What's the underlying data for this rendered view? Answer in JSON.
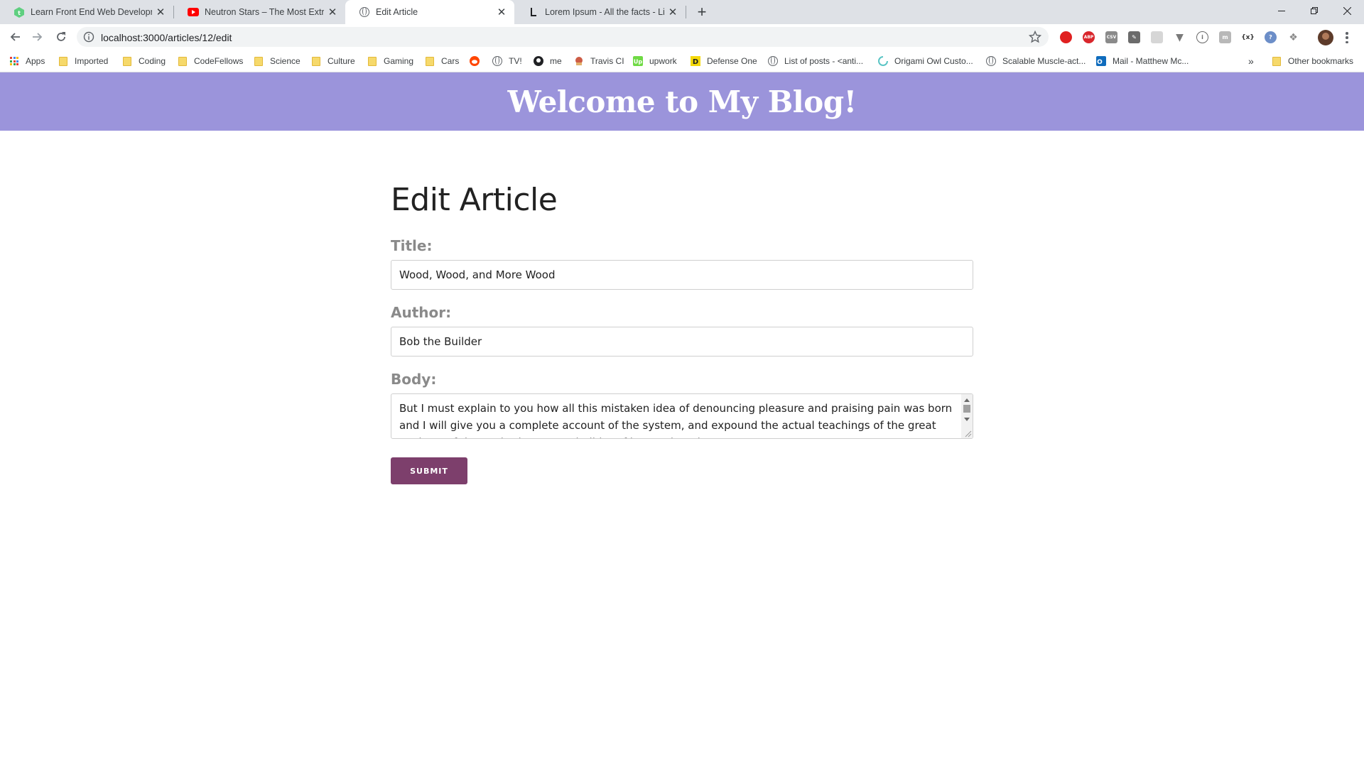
{
  "browser": {
    "tabs": [
      {
        "title": "Learn Front End Web Development",
        "active": false,
        "favicon": "treehouse-icon"
      },
      {
        "title": "Neutron Stars – The Most Extreme",
        "active": false,
        "favicon": "youtube-icon"
      },
      {
        "title": "Edit Article",
        "active": true,
        "favicon": "globe-icon"
      },
      {
        "title": "Lorem Ipsum - All the facts - Lipsum",
        "active": false,
        "favicon": "lipsum-icon"
      }
    ],
    "url": "localhost:3000/articles/12/edit",
    "bookmarks": [
      {
        "label": "Apps",
        "icon": "apps-grid-icon"
      },
      {
        "label": "Imported",
        "icon": "folder-icon"
      },
      {
        "label": "Coding",
        "icon": "folder-icon"
      },
      {
        "label": "CodeFellows",
        "icon": "folder-icon"
      },
      {
        "label": "Science",
        "icon": "folder-icon"
      },
      {
        "label": "Culture",
        "icon": "folder-icon"
      },
      {
        "label": "Gaming",
        "icon": "folder-icon"
      },
      {
        "label": "Cars",
        "icon": "folder-icon"
      },
      {
        "label": "",
        "icon": "reddit-icon"
      },
      {
        "label": "TV!",
        "icon": "globe-icon"
      },
      {
        "label": "me",
        "icon": "github-icon"
      },
      {
        "label": "Travis CI",
        "icon": "travis-icon"
      },
      {
        "label": "upwork",
        "icon": "upwork-icon"
      },
      {
        "label": "Defense One",
        "icon": "defense-one-icon"
      },
      {
        "label": "List of posts - <anti...",
        "icon": "globe-icon"
      },
      {
        "label": "Origami Owl Custo...",
        "icon": "origami-owl-icon"
      },
      {
        "label": "Scalable Muscle-act...",
        "icon": "globe-icon"
      },
      {
        "label": "Mail - Matthew Mc...",
        "icon": "outlook-icon"
      }
    ],
    "bookmarks_overflow": "»",
    "other_bookmarks": "Other bookmarks"
  },
  "site": {
    "title": "Welcome to My Blog!",
    "header_color": "#9b94db"
  },
  "form": {
    "heading": "Edit Article",
    "title_label": "Title:",
    "title_value": "Wood, Wood, and More Wood",
    "author_label": "Author:",
    "author_value": "Bob the Builder",
    "body_label": "Body:",
    "body_value": "But I must explain to you how all this mistaken idea of denouncing pleasure and praising pain was born and I will give you a complete account of the system, and expound the actual teachings of the great explorer of the truth, the master-builder of human happiness.",
    "submit_label": "SUBMIT",
    "submit_color": "#7d3f6c"
  }
}
